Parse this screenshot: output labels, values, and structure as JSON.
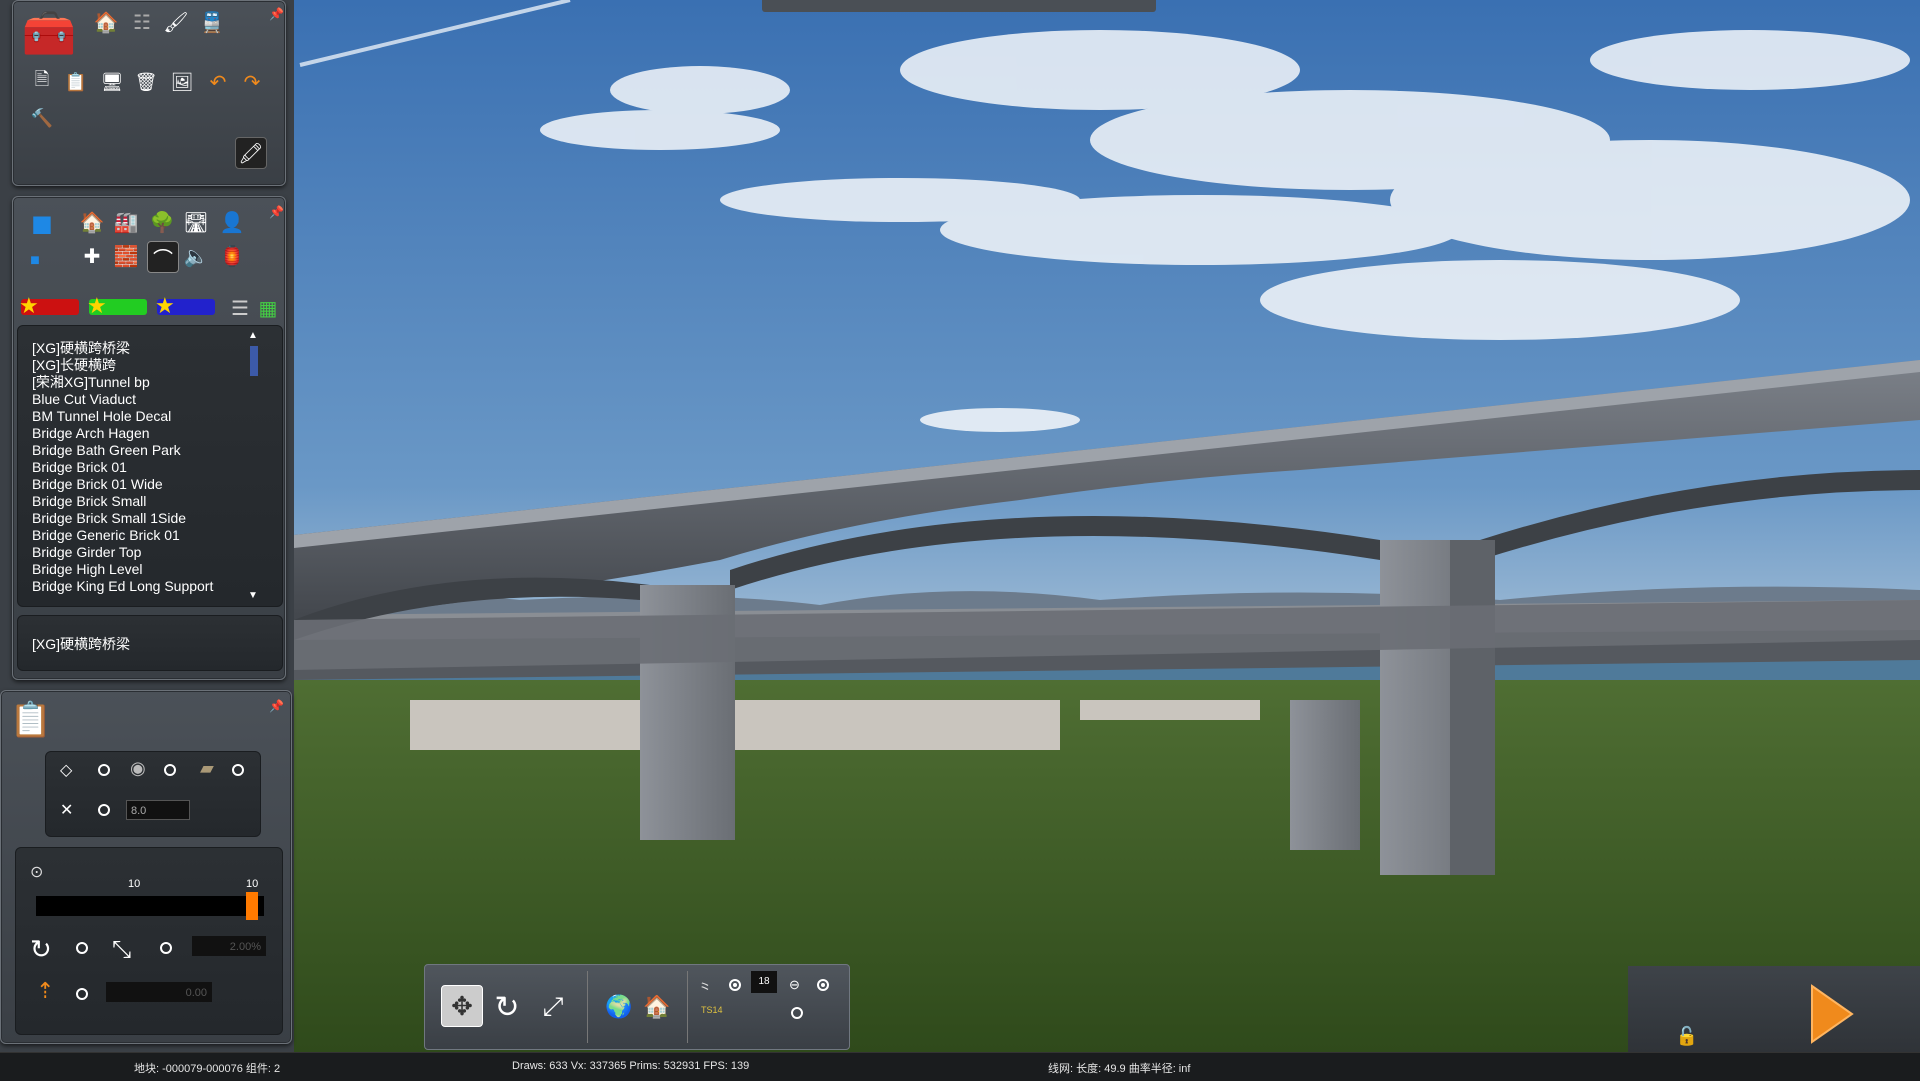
{
  "asset_list": {
    "items": [
      "[XG]硬横跨桥梁",
      "[XG]长硬横跨",
      "[荣湘XG]Tunnel bp",
      "Blue Cut Viaduct",
      "BM Tunnel Hole Decal",
      "Bridge Arch Hagen",
      "Bridge Bath Green Park",
      "Bridge Brick 01",
      "Bridge Brick 01 Wide",
      "Bridge Brick Small",
      "Bridge Brick Small 1Side",
      "Bridge Generic Brick 01",
      "Bridge Girder Top",
      "Bridge High Level",
      "Bridge King Ed Long Support"
    ],
    "selected": "[XG]硬横跨桥梁"
  },
  "properties": {
    "offset_value": "8.0",
    "slider_min_label": "10",
    "slider_max_label": "10",
    "slider_level": 0.97,
    "gradient_value": "2.00%",
    "height_value": "0.00"
  },
  "bottom_toolbar": {
    "track_number": "18",
    "ts_label": "TS14"
  },
  "status": {
    "tile": "地块: -000079-000076  组件: 2",
    "render_stats": "Draws: 633 Vx: 337365 Prims: 532931 FPS: 139",
    "track_info": "线网:   长度:   49.9 曲率半径:  inf"
  },
  "colors": {
    "sky_top": "#3f76b8",
    "ground": "#3d5e22",
    "concrete": "#6d7178",
    "play_orange": "#f08a1c",
    "slider_orange": "#ff7a00"
  }
}
